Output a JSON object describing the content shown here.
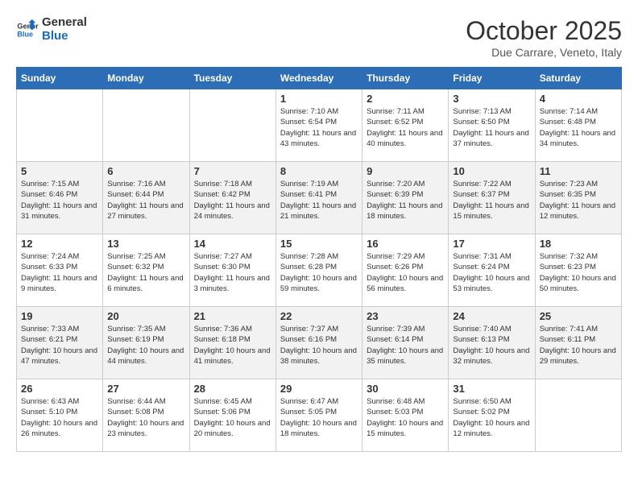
{
  "logo": {
    "line1": "General",
    "line2": "Blue"
  },
  "title": "October 2025",
  "subtitle": "Due Carrare, Veneto, Italy",
  "days_of_week": [
    "Sunday",
    "Monday",
    "Tuesday",
    "Wednesday",
    "Thursday",
    "Friday",
    "Saturday"
  ],
  "weeks": [
    [
      {
        "day": "",
        "info": ""
      },
      {
        "day": "",
        "info": ""
      },
      {
        "day": "",
        "info": ""
      },
      {
        "day": "1",
        "info": "Sunrise: 7:10 AM\nSunset: 6:54 PM\nDaylight: 11 hours and 43 minutes."
      },
      {
        "day": "2",
        "info": "Sunrise: 7:11 AM\nSunset: 6:52 PM\nDaylight: 11 hours and 40 minutes."
      },
      {
        "day": "3",
        "info": "Sunrise: 7:13 AM\nSunset: 6:50 PM\nDaylight: 11 hours and 37 minutes."
      },
      {
        "day": "4",
        "info": "Sunrise: 7:14 AM\nSunset: 6:48 PM\nDaylight: 11 hours and 34 minutes."
      }
    ],
    [
      {
        "day": "5",
        "info": "Sunrise: 7:15 AM\nSunset: 6:46 PM\nDaylight: 11 hours and 31 minutes."
      },
      {
        "day": "6",
        "info": "Sunrise: 7:16 AM\nSunset: 6:44 PM\nDaylight: 11 hours and 27 minutes."
      },
      {
        "day": "7",
        "info": "Sunrise: 7:18 AM\nSunset: 6:42 PM\nDaylight: 11 hours and 24 minutes."
      },
      {
        "day": "8",
        "info": "Sunrise: 7:19 AM\nSunset: 6:41 PM\nDaylight: 11 hours and 21 minutes."
      },
      {
        "day": "9",
        "info": "Sunrise: 7:20 AM\nSunset: 6:39 PM\nDaylight: 11 hours and 18 minutes."
      },
      {
        "day": "10",
        "info": "Sunrise: 7:22 AM\nSunset: 6:37 PM\nDaylight: 11 hours and 15 minutes."
      },
      {
        "day": "11",
        "info": "Sunrise: 7:23 AM\nSunset: 6:35 PM\nDaylight: 11 hours and 12 minutes."
      }
    ],
    [
      {
        "day": "12",
        "info": "Sunrise: 7:24 AM\nSunset: 6:33 PM\nDaylight: 11 hours and 9 minutes."
      },
      {
        "day": "13",
        "info": "Sunrise: 7:25 AM\nSunset: 6:32 PM\nDaylight: 11 hours and 6 minutes."
      },
      {
        "day": "14",
        "info": "Sunrise: 7:27 AM\nSunset: 6:30 PM\nDaylight: 11 hours and 3 minutes."
      },
      {
        "day": "15",
        "info": "Sunrise: 7:28 AM\nSunset: 6:28 PM\nDaylight: 10 hours and 59 minutes."
      },
      {
        "day": "16",
        "info": "Sunrise: 7:29 AM\nSunset: 6:26 PM\nDaylight: 10 hours and 56 minutes."
      },
      {
        "day": "17",
        "info": "Sunrise: 7:31 AM\nSunset: 6:24 PM\nDaylight: 10 hours and 53 minutes."
      },
      {
        "day": "18",
        "info": "Sunrise: 7:32 AM\nSunset: 6:23 PM\nDaylight: 10 hours and 50 minutes."
      }
    ],
    [
      {
        "day": "19",
        "info": "Sunrise: 7:33 AM\nSunset: 6:21 PM\nDaylight: 10 hours and 47 minutes."
      },
      {
        "day": "20",
        "info": "Sunrise: 7:35 AM\nSunset: 6:19 PM\nDaylight: 10 hours and 44 minutes."
      },
      {
        "day": "21",
        "info": "Sunrise: 7:36 AM\nSunset: 6:18 PM\nDaylight: 10 hours and 41 minutes."
      },
      {
        "day": "22",
        "info": "Sunrise: 7:37 AM\nSunset: 6:16 PM\nDaylight: 10 hours and 38 minutes."
      },
      {
        "day": "23",
        "info": "Sunrise: 7:39 AM\nSunset: 6:14 PM\nDaylight: 10 hours and 35 minutes."
      },
      {
        "day": "24",
        "info": "Sunrise: 7:40 AM\nSunset: 6:13 PM\nDaylight: 10 hours and 32 minutes."
      },
      {
        "day": "25",
        "info": "Sunrise: 7:41 AM\nSunset: 6:11 PM\nDaylight: 10 hours and 29 minutes."
      }
    ],
    [
      {
        "day": "26",
        "info": "Sunrise: 6:43 AM\nSunset: 5:10 PM\nDaylight: 10 hours and 26 minutes."
      },
      {
        "day": "27",
        "info": "Sunrise: 6:44 AM\nSunset: 5:08 PM\nDaylight: 10 hours and 23 minutes."
      },
      {
        "day": "28",
        "info": "Sunrise: 6:45 AM\nSunset: 5:06 PM\nDaylight: 10 hours and 20 minutes."
      },
      {
        "day": "29",
        "info": "Sunrise: 6:47 AM\nSunset: 5:05 PM\nDaylight: 10 hours and 18 minutes."
      },
      {
        "day": "30",
        "info": "Sunrise: 6:48 AM\nSunset: 5:03 PM\nDaylight: 10 hours and 15 minutes."
      },
      {
        "day": "31",
        "info": "Sunrise: 6:50 AM\nSunset: 5:02 PM\nDaylight: 10 hours and 12 minutes."
      },
      {
        "day": "",
        "info": ""
      }
    ]
  ]
}
